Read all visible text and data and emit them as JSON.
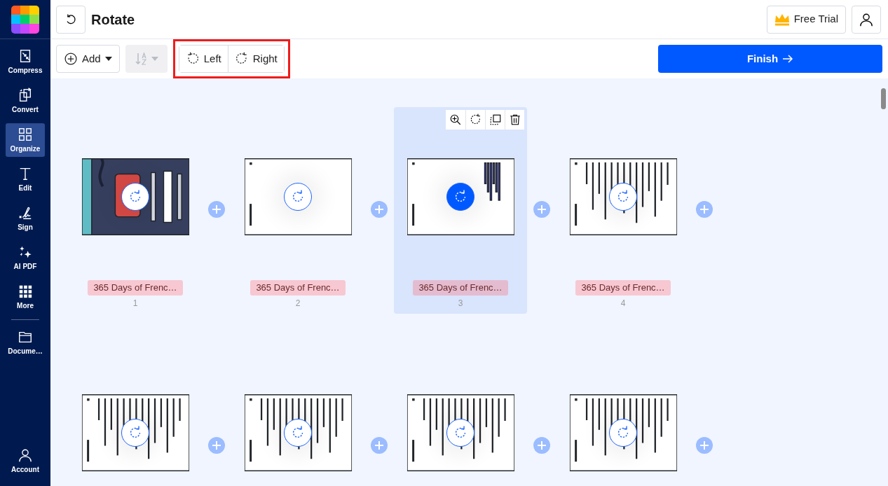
{
  "sidebar": {
    "items": [
      {
        "label": "Compress",
        "selected": false
      },
      {
        "label": "Convert",
        "selected": false
      },
      {
        "label": "Organize",
        "selected": true
      },
      {
        "label": "Edit",
        "selected": false
      },
      {
        "label": "Sign",
        "selected": false
      },
      {
        "label": "AI PDF",
        "selected": false
      },
      {
        "label": "More",
        "selected": false
      },
      {
        "label": "Docume…",
        "selected": false
      }
    ],
    "account": {
      "label": "Account"
    }
  },
  "header": {
    "title": "Rotate",
    "trial_button": "Free Trial"
  },
  "toolbar": {
    "add_button": "Add",
    "sort_disabled": true,
    "rotate_group": {
      "highlighted": true,
      "buttons": [
        {
          "label": "Left"
        },
        {
          "label": "Right"
        }
      ]
    },
    "finish_button": "Finish"
  },
  "pages": [
    {
      "kind": "cover",
      "label": "365 Days of Frenc…",
      "number": "1",
      "selected": false
    },
    {
      "kind": "blank",
      "label": "365 Days of Frenc…",
      "number": "2",
      "selected": false
    },
    {
      "kind": "links",
      "label": "365 Days of Frenc…",
      "number": "3",
      "selected": true
    },
    {
      "kind": "text",
      "label": "365 Days of Frenc…",
      "number": "4",
      "selected": false
    },
    {
      "kind": "text",
      "selected": false
    },
    {
      "kind": "text",
      "selected": false
    },
    {
      "kind": "text",
      "selected": false
    },
    {
      "kind": "text",
      "selected": false
    }
  ]
}
